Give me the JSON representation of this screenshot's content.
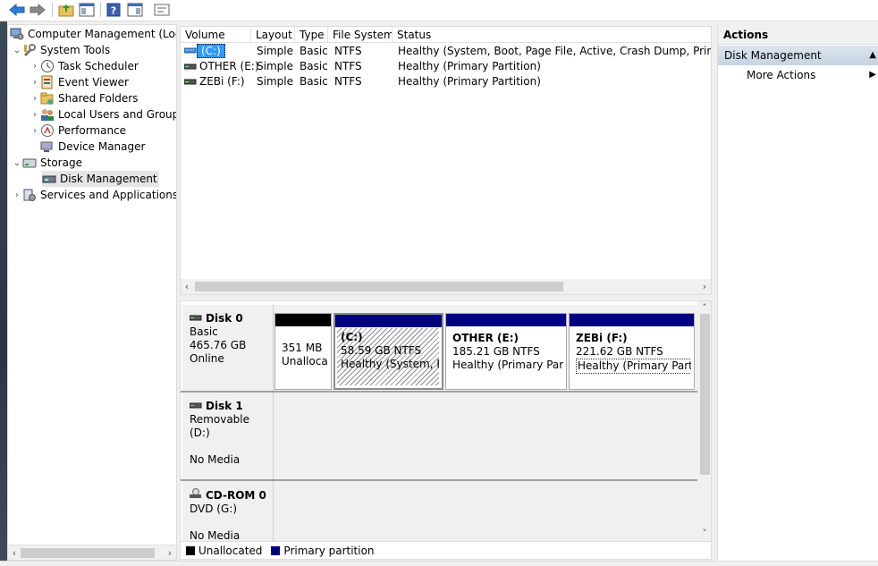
{
  "colors": {
    "unallocated": "#000000",
    "primary": "#000080",
    "selection": "#3399ff",
    "accent_header": "#c6d3e2"
  },
  "toolbar": {
    "icons": [
      "back-icon",
      "forward-icon",
      "up-folder-icon",
      "show-hide-console-tree-icon",
      "help-icon",
      "show-action-pane-icon",
      "properties-icon"
    ]
  },
  "tree": {
    "root": "Computer Management (Local",
    "system_tools": "System Tools",
    "task_scheduler": "Task Scheduler",
    "event_viewer": "Event Viewer",
    "shared_folders": "Shared Folders",
    "local_users": "Local Users and Groups",
    "performance": "Performance",
    "device_manager": "Device Manager",
    "storage": "Storage",
    "disk_management": "Disk Management",
    "services": "Services and Applications"
  },
  "volume_list": {
    "columns": [
      "Volume",
      "Layout",
      "Type",
      "File System",
      "Status"
    ],
    "rows": [
      {
        "volume": "(C:)",
        "layout": "Simple",
        "type": "Basic",
        "fs": "NTFS",
        "status": "Healthy (System, Boot, Page File, Active, Crash Dump, Primary Part"
      },
      {
        "volume": "OTHER (E:)",
        "layout": "Simple",
        "type": "Basic",
        "fs": "NTFS",
        "status": "Healthy (Primary Partition)"
      },
      {
        "volume": "ZEBi (F:)",
        "layout": "Simple",
        "type": "Basic",
        "fs": "NTFS",
        "status": "Healthy (Primary Partition)"
      }
    ]
  },
  "disks": {
    "disk0": {
      "name": "Disk 0",
      "type": "Basic",
      "size": "465.76 GB",
      "state": "Online",
      "partitions": [
        {
          "title": "",
          "size": "351 MB",
          "status": "Unallocat"
        },
        {
          "title": "(C:)",
          "size": "58.59 GB NTFS",
          "status": "Healthy (System, Boc"
        },
        {
          "title": "OTHER  (E:)",
          "size": "185.21 GB NTFS",
          "status": "Healthy (Primary Partiti"
        },
        {
          "title": "ZEBi  (F:)",
          "size": "221.62 GB NTFS",
          "status": "Healthy (Primary Partition)"
        }
      ]
    },
    "disk1": {
      "name": "Disk 1",
      "type": "Removable (D:)",
      "state": "No Media"
    },
    "cdrom0": {
      "name": "CD-ROM 0",
      "type": "DVD (G:)",
      "state": "No Media"
    }
  },
  "legend": {
    "unallocated": "Unallocated",
    "primary": "Primary partition"
  },
  "actions": {
    "title": "Actions",
    "section": "Disk Management",
    "more": "More Actions"
  }
}
